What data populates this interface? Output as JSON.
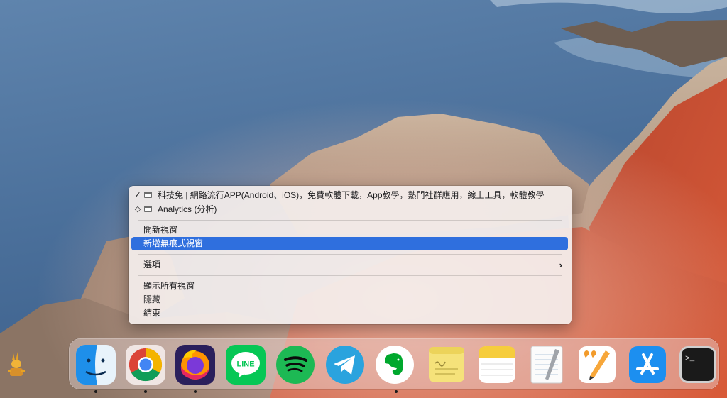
{
  "context_menu": {
    "windows": [
      {
        "checked": true,
        "mark": "✓",
        "title": "科技兔 | 網路流行APP(Android、iOS)，免費軟體下載，App教學，熱門社群應用，線上工具，軟體教學"
      },
      {
        "checked": false,
        "mark": "◇",
        "title": "Analytics (分析)"
      }
    ],
    "new_window": "開新視窗",
    "new_incognito_window": "新增無痕式視窗",
    "options": "選項",
    "options_chevron": "›",
    "show_all_windows": "顯示所有視窗",
    "hide": "隱藏",
    "quit": "結束"
  },
  "dock": {
    "apps": [
      {
        "name": "Finder",
        "icon": "finder-icon",
        "running": true
      },
      {
        "name": "Google Chrome",
        "icon": "chrome-icon",
        "running": true
      },
      {
        "name": "Firefox",
        "icon": "firefox-icon",
        "running": true
      },
      {
        "name": "LINE",
        "icon": "line-icon",
        "label": "LINE",
        "running": false
      },
      {
        "name": "Spotify",
        "icon": "spotify-icon",
        "running": false
      },
      {
        "name": "Telegram",
        "icon": "telegram-icon",
        "running": false
      },
      {
        "name": "Evernote",
        "icon": "evernote-icon",
        "running": true
      },
      {
        "name": "Stickies",
        "icon": "stickies-icon",
        "running": false
      },
      {
        "name": "Notes",
        "icon": "notes-icon",
        "running": false
      },
      {
        "name": "TextEdit",
        "icon": "textedit-icon",
        "running": false
      },
      {
        "name": "Pages",
        "icon": "pages-icon",
        "running": false
      },
      {
        "name": "App Store",
        "icon": "app-store-icon",
        "running": false
      },
      {
        "name": "Terminal",
        "icon": "terminal-icon",
        "label": ">_",
        "running": false
      }
    ]
  },
  "colors": {
    "menu_highlight": "#2f6fde",
    "sea": "#4a6f9a",
    "rock": "#a88a72",
    "ice_plant": "#c8452c"
  }
}
